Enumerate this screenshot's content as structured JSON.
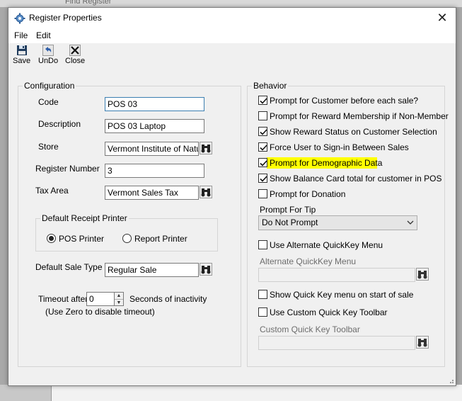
{
  "background": {
    "top_label": "Find Register"
  },
  "window": {
    "title": "Register Properties",
    "close_glyph": "✕"
  },
  "menu": {
    "file": "File",
    "edit": "Edit"
  },
  "toolbar": {
    "save": "Save",
    "undo": "UnDo",
    "close": "Close"
  },
  "configuration": {
    "group_label": "Configuration",
    "code": {
      "label": "Code",
      "value": "POS 03"
    },
    "description": {
      "label": "Description",
      "value": "POS 03 Laptop"
    },
    "store": {
      "label": "Store",
      "value": "Vermont Institute of Natural"
    },
    "register_number": {
      "label": "Register Number",
      "value": "3"
    },
    "tax_area": {
      "label": "Tax Area",
      "value": "Vermont Sales Tax"
    },
    "receipt_printer": {
      "group_label": "Default Receipt Printer",
      "pos_printer": "POS Printer",
      "report_printer": "Report Printer",
      "selected": "POS Printer"
    },
    "default_sale_type": {
      "label": "Default Sale Type",
      "value": "Regular Sale"
    },
    "timeout": {
      "label_before": "Timeout after",
      "value": "0",
      "label_after": "Seconds of inactivity",
      "hint": "(Use Zero to disable timeout)"
    }
  },
  "behavior": {
    "group_label": "Behavior",
    "checkboxes": [
      {
        "label": "Prompt for Customer before each sale?",
        "checked": true
      },
      {
        "label": "Prompt for Reward Membership if Non-Member",
        "checked": false
      },
      {
        "label": "Show Reward Status on Customer Selection",
        "checked": true
      },
      {
        "label": "Force User to Sign-in Between Sales",
        "checked": true
      },
      {
        "label": "Prompt for Demographic Data",
        "checked": true,
        "highlighted": true
      },
      {
        "label": "Show Balance Card total for customer in POS",
        "checked": true
      },
      {
        "label": "Prompt for Donation",
        "checked": false
      }
    ],
    "prompt_for_tip": {
      "label": "Prompt For Tip",
      "value": "Do Not Prompt"
    },
    "use_alt_quickkey": {
      "label": "Use Alternate QuickKey Menu",
      "checked": false
    },
    "alt_quickkey_menu": {
      "label": "Alternate QuickKey Menu",
      "value": ""
    },
    "show_quickkey_on_start": {
      "label": "Show Quick Key menu on start of sale",
      "checked": false
    },
    "use_custom_quickkey": {
      "label": "Use Custom Quick Key Toolbar",
      "checked": false
    },
    "custom_quickkey_toolbar": {
      "label": "Custom Quick Key Toolbar",
      "value": ""
    }
  },
  "colors": {
    "highlight": "#ffff00",
    "focus_border": "#3c7fb1",
    "window_bg": "#f0f0f0"
  }
}
